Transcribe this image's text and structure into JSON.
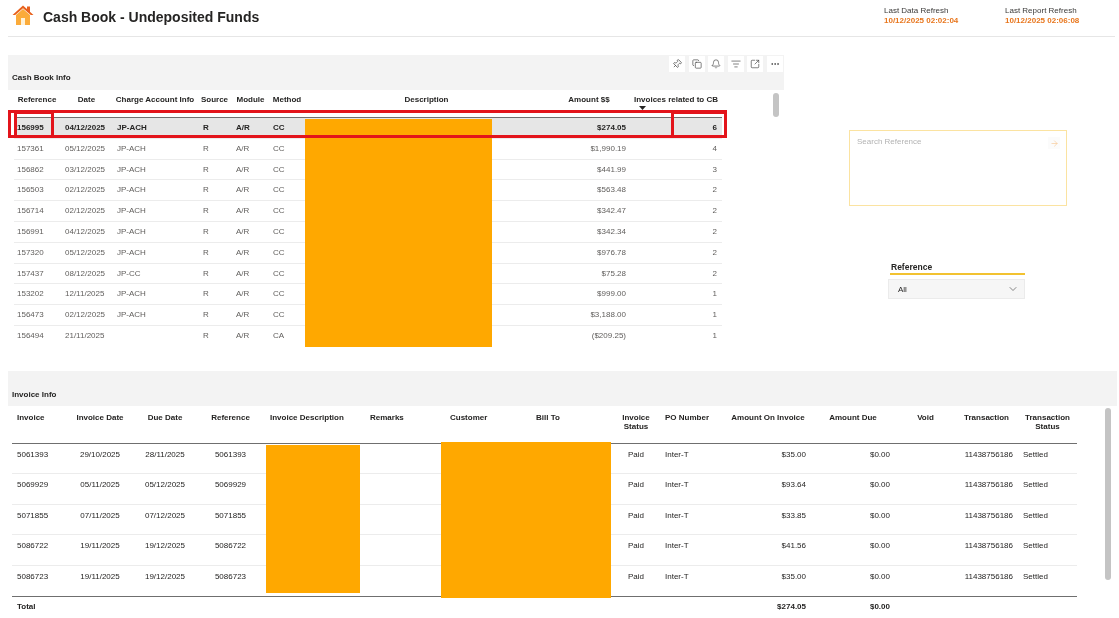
{
  "header": {
    "title": "Cash Book - Undeposited Funds",
    "refresh": [
      {
        "label": "Last Data Refresh",
        "value": "10/12/2025 02:02:04"
      },
      {
        "label": "Last Report Refresh",
        "value": "10/12/2025 02:06:08"
      }
    ]
  },
  "cash_book": {
    "title": "Cash Book Info",
    "columns": [
      {
        "label": "Reference",
        "marked": true
      },
      {
        "label": "Date"
      },
      {
        "label": "Charge Account Info"
      },
      {
        "label": "Source"
      },
      {
        "label": "Module"
      },
      {
        "label": "Method"
      },
      {
        "label": "Description",
        "redacted": true
      },
      {
        "label": "Amount $$"
      },
      {
        "label": "Invoices related to CB",
        "sorted_descending": true,
        "marked": true
      }
    ],
    "rows": [
      {
        "reference": "156995",
        "date": "04/12/2025",
        "charge_account_info": "JP-ACH",
        "source": "R",
        "module": "A/R",
        "method": "CC",
        "amount": "$274.05",
        "invoices_related": "6",
        "selected": true,
        "marked": true
      },
      {
        "reference": "157361",
        "date": "05/12/2025",
        "charge_account_info": "JP-ACH",
        "source": "R",
        "module": "A/R",
        "method": "CC",
        "amount": "$1,990.19",
        "invoices_related": "4",
        "selected": false,
        "marked": false
      },
      {
        "reference": "156862",
        "date": "03/12/2025",
        "charge_account_info": "JP-ACH",
        "source": "R",
        "module": "A/R",
        "method": "CC",
        "amount": "$441.99",
        "invoices_related": "3",
        "selected": false,
        "marked": false
      },
      {
        "reference": "156503",
        "date": "02/12/2025",
        "charge_account_info": "JP-ACH",
        "source": "R",
        "module": "A/R",
        "method": "CC",
        "amount": "$563.48",
        "invoices_related": "2",
        "selected": false,
        "marked": false
      },
      {
        "reference": "156714",
        "date": "02/12/2025",
        "charge_account_info": "JP-ACH",
        "source": "R",
        "module": "A/R",
        "method": "CC",
        "amount": "$342.47",
        "invoices_related": "2",
        "selected": false,
        "marked": false
      },
      {
        "reference": "156991",
        "date": "04/12/2025",
        "charge_account_info": "JP-ACH",
        "source": "R",
        "module": "A/R",
        "method": "CC",
        "amount": "$342.34",
        "invoices_related": "2",
        "selected": false,
        "marked": false
      },
      {
        "reference": "157320",
        "date": "05/12/2025",
        "charge_account_info": "JP-ACH",
        "source": "R",
        "module": "A/R",
        "method": "CC",
        "amount": "$976.78",
        "invoices_related": "2",
        "selected": false,
        "marked": false
      },
      {
        "reference": "157437",
        "date": "08/12/2025",
        "charge_account_info": "JP-CC",
        "source": "R",
        "module": "A/R",
        "method": "CC",
        "amount": "$75.28",
        "invoices_related": "2",
        "selected": false,
        "marked": false
      },
      {
        "reference": "153202",
        "date": "12/11/2025",
        "charge_account_info": "JP-ACH",
        "source": "R",
        "module": "A/R",
        "method": "CC",
        "amount": "$999.00",
        "invoices_related": "1",
        "selected": false,
        "marked": false
      },
      {
        "reference": "156473",
        "date": "02/12/2025",
        "charge_account_info": "JP-ACH",
        "source": "R",
        "module": "A/R",
        "method": "CC",
        "amount": "$3,188.00",
        "invoices_related": "1",
        "selected": false,
        "marked": false
      },
      {
        "reference": "156494",
        "date": "21/11/2025",
        "source": "R",
        "module": "A/R",
        "method": "CA",
        "amount": "($209.25)",
        "invoices_related": "1",
        "selected": false,
        "marked": false
      }
    ]
  },
  "search": {
    "placeholder": "Search Reference"
  },
  "slicer": {
    "label": "Reference",
    "value": "All"
  },
  "invoices": {
    "title": "Invoice Info",
    "columns": [
      {
        "label": "Invoice"
      },
      {
        "label": "Invoice Date"
      },
      {
        "label": "Due Date"
      },
      {
        "label": "Reference"
      },
      {
        "label": "Invoice Description",
        "redacted": true
      },
      {
        "label": "Remarks"
      },
      {
        "label": "Customer",
        "redacted": true
      },
      {
        "label": "Bill To",
        "redacted": true
      },
      {
        "label": "Invoice Status"
      },
      {
        "label": "PO Number"
      },
      {
        "label": "Amount On Invoice"
      },
      {
        "label": "Amount Due"
      },
      {
        "label": "Void"
      },
      {
        "label": "Transaction"
      },
      {
        "label": "Transaction Status"
      }
    ],
    "rows": [
      {
        "invoice": "5061393",
        "invoice_date": "29/10/2025",
        "due_date": "28/11/2025",
        "reference": "5061393",
        "invoice_status": "Paid",
        "po_number": "Inter-T",
        "amount_on_invoice": "$35.00",
        "amount_due": "$0.00",
        "transaction": "11438756186",
        "transaction_status": "Settled"
      },
      {
        "invoice": "5069929",
        "invoice_date": "05/11/2025",
        "due_date": "05/12/2025",
        "reference": "5069929",
        "invoice_status": "Paid",
        "po_number": "Inter-T",
        "amount_on_invoice": "$93.64",
        "amount_due": "$0.00",
        "transaction": "11438756186",
        "transaction_status": "Settled"
      },
      {
        "invoice": "5071855",
        "invoice_date": "07/11/2025",
        "due_date": "07/12/2025",
        "reference": "5071855",
        "invoice_status": "Paid",
        "po_number": "Inter-T",
        "amount_on_invoice": "$33.85",
        "amount_due": "$0.00",
        "transaction": "11438756186",
        "transaction_status": "Settled"
      },
      {
        "invoice": "5086722",
        "invoice_date": "19/11/2025",
        "due_date": "19/12/2025",
        "reference": "5086722",
        "invoice_status": "Paid",
        "po_number": "Inter-T",
        "amount_on_invoice": "$41.56",
        "amount_due": "$0.00",
        "transaction": "11438756186",
        "transaction_status": "Settled"
      },
      {
        "invoice": "5086723",
        "invoice_date": "19/11/2025",
        "due_date": "19/12/2025",
        "reference": "5086723",
        "invoice_status": "Paid",
        "po_number": "Inter-T",
        "amount_on_invoice": "$35.00",
        "amount_due": "$0.00",
        "transaction": "11438756186",
        "transaction_status": "Settled"
      }
    ],
    "total": {
      "label": "Total",
      "amount_on_invoice": "$274.05",
      "amount_due": "$0.00"
    }
  }
}
